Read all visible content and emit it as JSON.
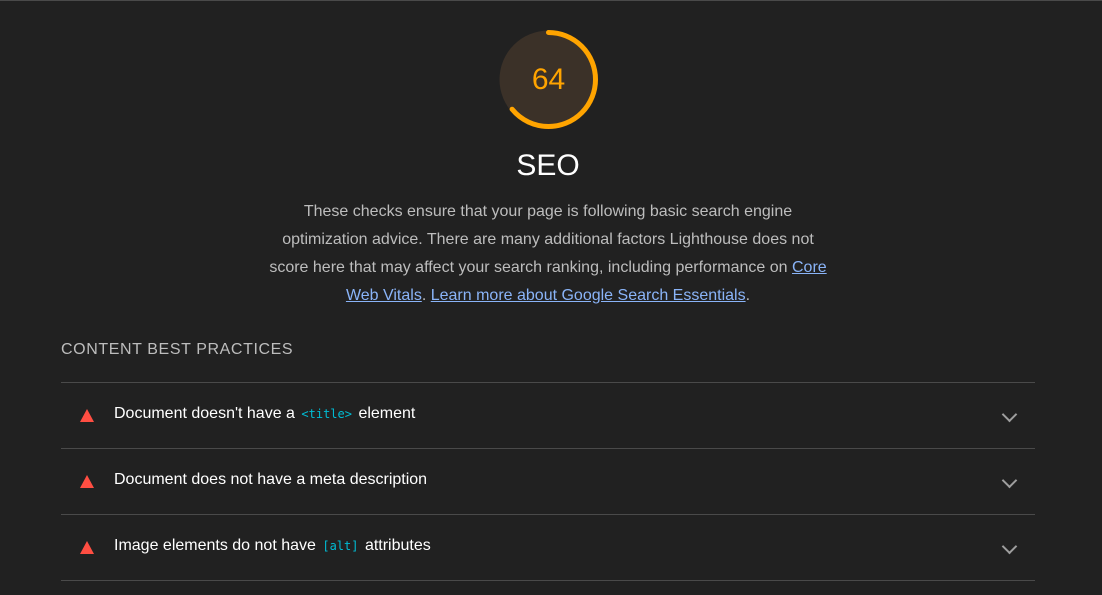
{
  "category": {
    "score": "64",
    "score_fraction": 0.64,
    "title": "SEO",
    "description_text": "These checks ensure that your page is following basic search engine optimization advice. There are many additional factors Lighthouse does not score here that may affect your search ranking, including performance on",
    "link_core_web_vitals": "Core Web Vitals",
    "separator": ".",
    "link_learn_more": "Learn more about Google Search Essentials",
    "end_period": ".",
    "gauge_color": "#ffa400",
    "gauge_bg": "#3b3128"
  },
  "group": {
    "title": "CONTENT BEST PRACTICES"
  },
  "audits": [
    {
      "status": "fail",
      "icon": "fail-triangle-icon",
      "prefix": "Document doesn't have a",
      "code": "<title>",
      "suffix": "element"
    },
    {
      "status": "fail",
      "icon": "fail-triangle-icon",
      "prefix": "Document does not have a meta description",
      "code": "",
      "suffix": ""
    },
    {
      "status": "fail",
      "icon": "fail-triangle-icon",
      "prefix": "Image elements do not have",
      "code": "[alt]",
      "suffix": "attributes"
    }
  ],
  "colors": {
    "fail": "#ff4e42",
    "link": "#8ab4f8",
    "code": "#00bcd4"
  }
}
